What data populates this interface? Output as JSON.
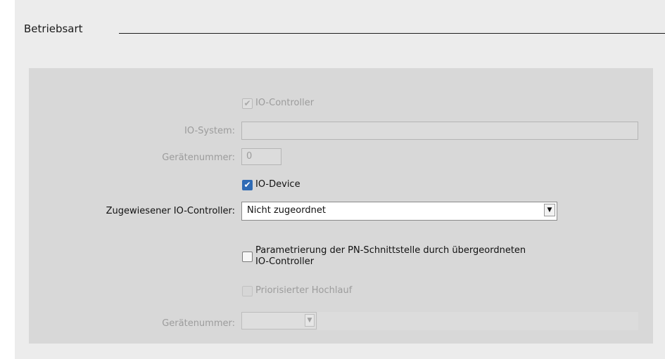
{
  "section": {
    "title": "Betriebsart"
  },
  "io_controller": {
    "label": "IO-Controller",
    "checked": true,
    "enabled": false
  },
  "io_system": {
    "label": "IO-System:",
    "value": ""
  },
  "device_number_1": {
    "label": "Gerätenummer:",
    "value": "0"
  },
  "io_device": {
    "label": "IO-Device",
    "checked": true
  },
  "assigned_controller": {
    "label": "Zugewiesener IO-Controller:",
    "selected": "Nicht zugeordnet"
  },
  "parametrization": {
    "label_line1": "Parametrierung der PN-Schnittstelle durch übergeordneten",
    "label_line2": "IO-Controller",
    "checked": false
  },
  "prioritized_startup": {
    "label": "Priorisierter Hochlauf",
    "checked": false,
    "enabled": false
  },
  "device_number_2": {
    "label": "Gerätenummer:",
    "value": ""
  },
  "colors": {
    "panel": "#d8d8d8",
    "checkbox_accent": "#2f6bb5",
    "disabled_text": "#9c9c9c"
  }
}
